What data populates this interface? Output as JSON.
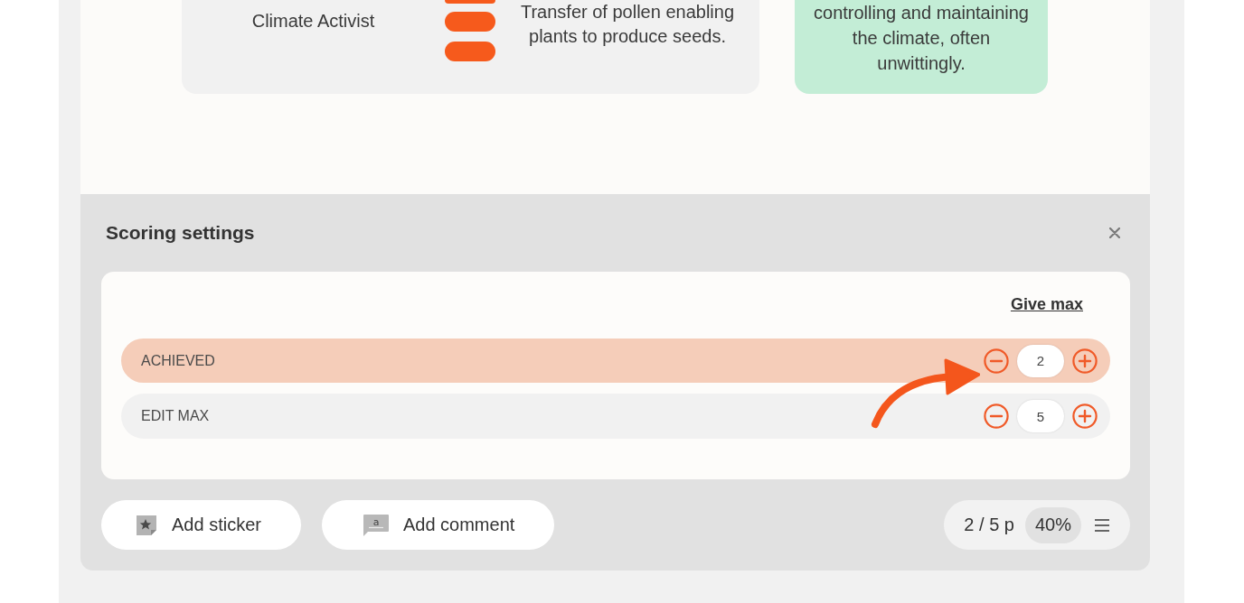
{
  "worksheet": {
    "term": "Climate Activist",
    "definition": "Transfer of pollen enabling plants to produce seeds.",
    "answer": "controlling and maintaining the climate, often unwittingly."
  },
  "scoring": {
    "title": "Scoring settings",
    "give_max": "Give max",
    "rows": [
      {
        "label": "ACHIEVED",
        "value": "2",
        "selected": true
      },
      {
        "label": "EDIT MAX",
        "value": "5",
        "selected": false
      }
    ]
  },
  "actions": [
    {
      "kind": "sticker",
      "label": "Add sticker"
    },
    {
      "kind": "comment",
      "label": "Add comment",
      "icon_glyph": "a"
    }
  ],
  "score": {
    "points": "2 / 5 p",
    "percent": "40%"
  }
}
